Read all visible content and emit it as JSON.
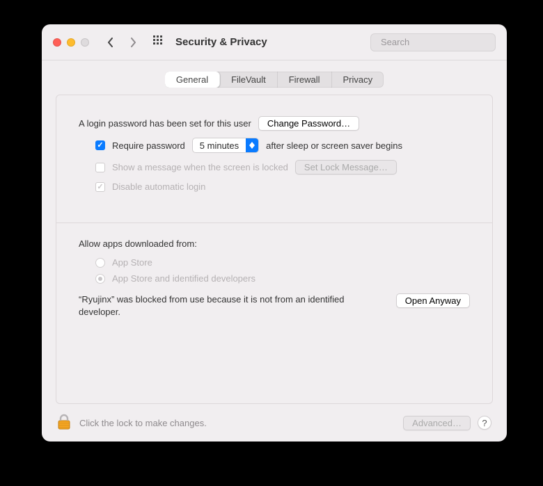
{
  "window": {
    "title": "Security & Privacy"
  },
  "search": {
    "placeholder": "Search",
    "value": ""
  },
  "tabs": [
    {
      "label": "General",
      "active": true
    },
    {
      "label": "FileVault",
      "active": false
    },
    {
      "label": "Firewall",
      "active": false
    },
    {
      "label": "Privacy",
      "active": false
    }
  ],
  "login": {
    "password_set_text": "A login password has been set for this user",
    "change_password_label": "Change Password…",
    "require_password_label": "Require password",
    "require_password_checked": true,
    "delay_options_selected": "5 minutes",
    "after_text": "after sleep or screen saver begins",
    "show_message_label": "Show a message when the screen is locked",
    "show_message_checked": false,
    "set_lock_message_label": "Set Lock Message…",
    "disable_auto_login_label": "Disable automatic login",
    "disable_auto_login_checked": true
  },
  "downloads": {
    "heading": "Allow apps downloaded from:",
    "options": [
      {
        "label": "App Store",
        "selected": false
      },
      {
        "label": "App Store and identified developers",
        "selected": true
      }
    ],
    "blocked_message": "“Ryujinx” was blocked from use because it is not from an identified developer.",
    "open_anyway_label": "Open Anyway"
  },
  "footer": {
    "lock_note": "Click the lock to make changes.",
    "advanced_label": "Advanced…"
  }
}
